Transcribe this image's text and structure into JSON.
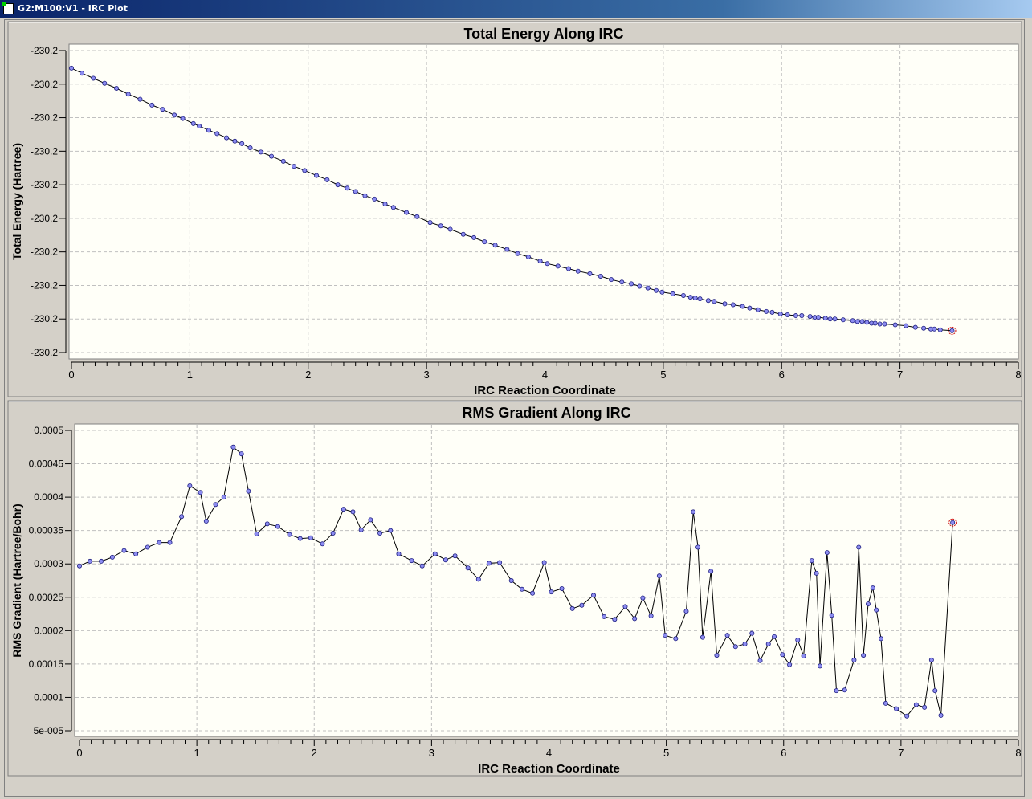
{
  "window": {
    "title": "G2:M100:V1 - IRC Plot"
  },
  "chart_data": [
    {
      "type": "line",
      "title": "Total Energy Along IRC",
      "xlabel": "IRC Reaction Coordinate",
      "ylabel": "Total Energy (Hartree)",
      "xlim": [
        0,
        8
      ],
      "ylim": [
        -230.232,
        -230.196
      ],
      "xticks": [
        "0",
        "1",
        "2",
        "3",
        "4",
        "5",
        "6",
        "7",
        "8"
      ],
      "yticks": [
        "-230.2",
        "-230.2",
        "-230.2",
        "-230.2",
        "-230.2",
        "-230.2",
        "-230.2",
        "-230.2",
        "-230.2",
        "-230.2"
      ],
      "grid": true,
      "highlighted_point": "last",
      "colors": {
        "marker": "#8c8cf0",
        "line": "#000000",
        "highlight": "#d01010",
        "plot_bg": "#fffff8"
      },
      "x": [
        0,
        0.089,
        0.185,
        0.28,
        0.38,
        0.48,
        0.58,
        0.68,
        0.77,
        0.87,
        0.94,
        1.03,
        1.08,
        1.16,
        1.23,
        1.31,
        1.38,
        1.44,
        1.51,
        1.6,
        1.69,
        1.79,
        1.88,
        1.97,
        2.07,
        2.16,
        2.25,
        2.33,
        2.4,
        2.48,
        2.56,
        2.65,
        2.72,
        2.83,
        2.92,
        3.03,
        3.12,
        3.2,
        3.31,
        3.4,
        3.49,
        3.58,
        3.68,
        3.77,
        3.86,
        3.96,
        4.02,
        4.11,
        4.2,
        4.28,
        4.38,
        4.47,
        4.56,
        4.65,
        4.73,
        4.8,
        4.87,
        4.94,
        4.99,
        5.08,
        5.17,
        5.23,
        5.27,
        5.31,
        5.38,
        5.43,
        5.52,
        5.59,
        5.67,
        5.73,
        5.8,
        5.87,
        5.92,
        5.99,
        6.05,
        6.12,
        6.17,
        6.24,
        6.28,
        6.31,
        6.37,
        6.41,
        6.45,
        6.52,
        6.6,
        6.64,
        6.68,
        6.72,
        6.76,
        6.79,
        6.83,
        6.87,
        6.96,
        7.05,
        7.13,
        7.2,
        7.26,
        7.29,
        7.34,
        7.44
      ],
      "y": [
        -230.1981,
        -230.1987,
        -230.1993,
        -230.1999,
        -230.2005,
        -230.2012,
        -230.2018,
        -230.2025,
        -230.203,
        -230.2037,
        -230.2041,
        -230.2047,
        -230.205,
        -230.2055,
        -230.2059,
        -230.2064,
        -230.2068,
        -230.2071,
        -230.2076,
        -230.2081,
        -230.2086,
        -230.2092,
        -230.2098,
        -230.2103,
        -230.2109,
        -230.2114,
        -230.212,
        -230.2124,
        -230.2128,
        -230.2133,
        -230.2137,
        -230.2143,
        -230.2147,
        -230.2153,
        -230.2158,
        -230.2165,
        -230.2169,
        -230.2173,
        -230.2179,
        -230.2183,
        -230.2188,
        -230.2192,
        -230.2197,
        -230.2202,
        -230.2206,
        -230.2211,
        -230.2214,
        -230.2217,
        -230.222,
        -230.2223,
        -230.2226,
        -230.2229,
        -230.2233,
        -230.2236,
        -230.2238,
        -230.2241,
        -230.2243,
        -230.2246,
        -230.2248,
        -230.225,
        -230.2252,
        -230.2254,
        -230.2255,
        -230.2256,
        -230.2258,
        -230.2259,
        -230.2262,
        -230.2263,
        -230.2265,
        -230.2267,
        -230.2269,
        -230.2271,
        -230.2272,
        -230.2274,
        -230.2275,
        -230.2276,
        -230.2276,
        -230.2277,
        -230.2278,
        -230.2278,
        -230.2279,
        -230.228,
        -230.228,
        -230.2281,
        -230.2282,
        -230.2283,
        -230.2283,
        -230.2284,
        -230.2285,
        -230.2285,
        -230.2286,
        -230.2286,
        -230.2287,
        -230.2288,
        -230.229,
        -230.2291,
        -230.2292,
        -230.2292,
        -230.2293,
        -230.2294
      ]
    },
    {
      "type": "line",
      "title": "RMS Gradient Along IRC",
      "xlabel": "IRC Reaction Coordinate",
      "ylabel": "RMS Gradient (Hartree/Bohr)",
      "xlim": [
        0,
        8
      ],
      "ylim": [
        5e-05,
        0.0005
      ],
      "xticks": [
        "0",
        "1",
        "2",
        "3",
        "4",
        "5",
        "6",
        "7",
        "8"
      ],
      "yticks": [
        "0.0005",
        "0.00045",
        "0.0004",
        "0.00035",
        "0.0003",
        "0.00025",
        "0.0002",
        "0.00015",
        "0.0001",
        "5e-005"
      ],
      "grid": true,
      "highlighted_point": "last",
      "colors": {
        "marker": "#8c8cf0",
        "line": "#000000",
        "highlight": "#d01010",
        "plot_bg": "#fffff8"
      },
      "x": [
        0,
        0.089,
        0.185,
        0.28,
        0.38,
        0.48,
        0.58,
        0.68,
        0.77,
        0.87,
        0.94,
        1.03,
        1.08,
        1.16,
        1.23,
        1.31,
        1.38,
        1.44,
        1.51,
        1.6,
        1.69,
        1.79,
        1.88,
        1.97,
        2.07,
        2.16,
        2.25,
        2.33,
        2.4,
        2.48,
        2.56,
        2.65,
        2.72,
        2.83,
        2.92,
        3.03,
        3.12,
        3.2,
        3.31,
        3.4,
        3.49,
        3.58,
        3.68,
        3.77,
        3.86,
        3.96,
        4.02,
        4.11,
        4.2,
        4.28,
        4.38,
        4.47,
        4.56,
        4.65,
        4.73,
        4.8,
        4.87,
        4.94,
        4.99,
        5.08,
        5.17,
        5.23,
        5.27,
        5.31,
        5.38,
        5.43,
        5.52,
        5.59,
        5.67,
        5.73,
        5.8,
        5.87,
        5.92,
        5.99,
        6.05,
        6.12,
        6.17,
        6.24,
        6.28,
        6.31,
        6.37,
        6.41,
        6.45,
        6.52,
        6.6,
        6.64,
        6.68,
        6.72,
        6.76,
        6.79,
        6.83,
        6.87,
        6.96,
        7.05,
        7.13,
        7.2,
        7.26,
        7.29,
        7.34,
        7.44
      ],
      "y": [
        0.000297,
        0.000304,
        0.000304,
        0.00031,
        0.00032,
        0.000315,
        0.000325,
        0.000332,
        0.000332,
        0.000371,
        0.000417,
        0.000407,
        0.000364,
        0.000389,
        0.0004,
        0.000475,
        0.000465,
        0.000409,
        0.000345,
        0.00036,
        0.000356,
        0.000344,
        0.000338,
        0.000339,
        0.00033,
        0.000346,
        0.000382,
        0.000378,
        0.000351,
        0.000366,
        0.000346,
        0.00035,
        0.000315,
        0.000305,
        0.000297,
        0.000315,
        0.000306,
        0.000312,
        0.000294,
        0.000277,
        0.000301,
        0.000302,
        0.000275,
        0.000262,
        0.000256,
        0.000302,
        0.000258,
        0.000263,
        0.000233,
        0.000238,
        0.000253,
        0.000221,
        0.000217,
        0.000236,
        0.000218,
        0.000249,
        0.000222,
        0.000282,
        0.000193,
        0.000188,
        0.000229,
        0.000378,
        0.000325,
        0.00019,
        0.000289,
        0.000163,
        0.000193,
        0.000176,
        0.00018,
        0.000196,
        0.000155,
        0.00018,
        0.000191,
        0.000164,
        0.000149,
        0.000186,
        0.000162,
        0.000305,
        0.000286,
        0.000147,
        0.000317,
        0.000223,
        0.00011,
        0.000111,
        0.000156,
        0.000325,
        0.000163,
        0.00024,
        0.000264,
        0.000231,
        0.000188,
        9.1e-05,
        8.3e-05,
        7.2e-05,
        8.9e-05,
        8.5e-05,
        0.000156,
        0.00011,
        7.3e-05,
        0.000362
      ]
    }
  ]
}
